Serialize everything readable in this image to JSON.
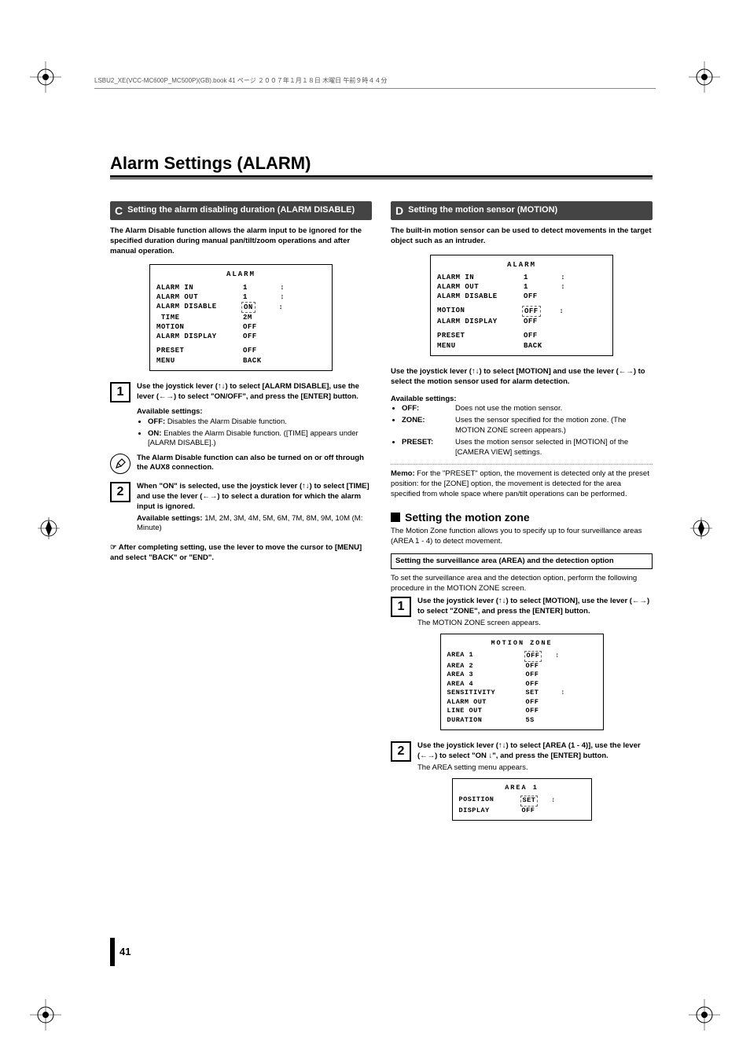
{
  "header_text": "LSBU2_XE(VCC-MC600P_MC500P)(GB).book  41 ページ  ２００７年１月１８日  木曜日  午前９時４４分",
  "page_title": "Alarm Settings (ALARM)",
  "page_number": "41",
  "c": {
    "letter": "C",
    "title": "Setting the alarm disabling duration (ALARM DISABLE)",
    "intro": "The Alarm Disable function allows the alarm input to be ignored for the specified duration during manual pan/tilt/zoom operations and after manual operation.",
    "osd": {
      "title": "ALARM",
      "rows": [
        {
          "k": "ALARM IN",
          "v": "1       ↕"
        },
        {
          "k": "ALARM OUT",
          "v": "1       ↕"
        },
        {
          "k": "ALARM DISABLE",
          "v": "ON",
          "dashed": true,
          "arrow": "↕"
        },
        {
          "k": " TIME",
          "v": "2M"
        },
        {
          "k": "MOTION",
          "v": "OFF"
        },
        {
          "k": "ALARM DISPLAY",
          "v": "OFF"
        }
      ],
      "rows2": [
        {
          "k": "PRESET",
          "v": "OFF"
        },
        {
          "k": "MENU",
          "v": "BACK"
        }
      ]
    },
    "step1": "Use the joystick lever (↑↓) to select [ALARM DISABLE], use the lever (←→) to select \"ON/OFF\", and press the [ENTER] button.",
    "avail_label": "Available settings:",
    "off": {
      "k": "OFF:",
      "v": "Disables the Alarm Disable function."
    },
    "on": {
      "k": "ON:",
      "v": "Enables the Alarm Disable function. ([TIME] appears under [ALARM DISABLE].)"
    },
    "note": "The Alarm Disable function can also be turned on or off through the AUX8 connection.",
    "step2_lead": "When \"ON\" is selected, use the joystick lever (↑↓) to select [TIME] and use the lever (←→) to select a duration for which the alarm input is ignored.",
    "step2_sub_label": "Available settings:",
    "step2_sub_val": "1M, 2M, 3M, 4M, 5M, 6M, 7M, 8M, 9M, 10M (M: Minute)",
    "footnote": "☞ After completing setting, use the lever to move the cursor to [MENU] and select \"BACK\" or \"END\"."
  },
  "d": {
    "letter": "D",
    "title": "Setting the motion sensor (MOTION)",
    "intro": "The built-in motion sensor can be used to detect movements in the target object such as an intruder.",
    "osd": {
      "title": "ALARM",
      "rows": [
        {
          "k": "ALARM IN",
          "v": "1       ↕"
        },
        {
          "k": "ALARM OUT",
          "v": "1       ↕"
        },
        {
          "k": "ALARM DISABLE",
          "v": "OFF"
        }
      ],
      "rows_mid": [
        {
          "k": "MOTION",
          "v": "OFF",
          "dashed": true,
          "arrow": "↕"
        },
        {
          "k": "ALARM DISPLAY",
          "v": "OFF"
        }
      ],
      "rows2": [
        {
          "k": "PRESET",
          "v": "OFF"
        },
        {
          "k": "MENU",
          "v": "BACK"
        }
      ]
    },
    "use_line": "Use the joystick lever (↑↓) to select [MOTION] and use the lever (←→) to select the motion sensor used for alarm detection.",
    "avail_label": "Available settings:",
    "settings": [
      {
        "k": "OFF:",
        "v": "Does not use the motion sensor."
      },
      {
        "k": "ZONE:",
        "v": "Uses the sensor specified for the motion zone. (The MOTION ZONE screen appears.)"
      },
      {
        "k": "PRESET:",
        "v": "Uses the motion sensor selected in [MOTION] of the [CAMERA VIEW] settings."
      }
    ],
    "memo_label": "Memo:",
    "memo_text": "For the \"PRESET\" option, the movement is detected only at the preset position: for the [ZONE] option, the movement is detected for the area specified from whole space where pan/tilt operations can be performed.",
    "subhead": "Setting the motion zone",
    "subpara": "The Motion Zone function allows you to specify up to four surveillance areas (AREA 1 - 4) to detect movement.",
    "framed": "Setting the surveillance area (AREA) and the detection option",
    "framed_para": "To set the surveillance area and the detection option, perform the following procedure in the MOTION ZONE screen.",
    "step1": "Use the joystick lever (↑↓) to select [MOTION], use the lever (←→) to select \"ZONE\", and press the [ENTER] button.",
    "step1_sub": "The MOTION ZONE screen appears.",
    "osd2": {
      "title": "MOTION ZONE",
      "rows": [
        {
          "k": "AREA 1",
          "v": "OFF",
          "dashed": true,
          "arrow": "↕"
        },
        {
          "k": "AREA 2",
          "v": "OFF"
        },
        {
          "k": "AREA 3",
          "v": "OFF"
        },
        {
          "k": "AREA 4",
          "v": "OFF"
        },
        {
          "k": "SENSITIVITY",
          "v": "SET     ↕"
        },
        {
          "k": "ALARM OUT",
          "v": "OFF"
        },
        {
          "k": "LINE OUT",
          "v": "OFF"
        },
        {
          "k": "DURATION",
          "v": "5S"
        }
      ]
    },
    "step2": "Use the joystick lever (↑↓) to select [AREA (1 - 4)], use the lever (←→) to select \"ON ↓\", and press the [ENTER] button.",
    "step2_sub": "The AREA setting menu appears.",
    "osd3": {
      "title": "AREA 1",
      "rows": [
        {
          "k": "POSITION",
          "v": "SET",
          "dashed": true,
          "arrow": "↕"
        },
        {
          "k": "DISPLAY",
          "v": "OFF"
        }
      ]
    }
  }
}
